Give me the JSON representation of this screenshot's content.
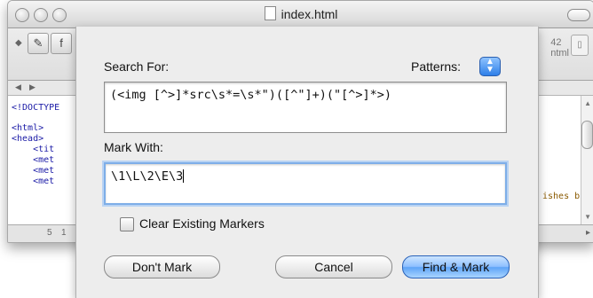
{
  "window": {
    "title": "index.html",
    "toolbar_right_top": "42",
    "toolbar_right_bottom": "ntml",
    "code_lines": [
      "<!DOCTYPE",
      "<html>",
      "<head>",
      "    <tit",
      "    <met",
      "    <met",
      "    <met"
    ],
    "code_tail": "ishes b",
    "status_line": "5",
    "status_col": "1"
  },
  "dialog": {
    "search_label": "Search For:",
    "patterns_label": "Patterns:",
    "search_value": "(<img [^>]*src\\s*=\\s*\")([^\"]+)(\"[^>]*>)",
    "mark_label": "Mark With:",
    "mark_value": "\\1\\L\\2\\E\\3",
    "clear_markers_label": "Clear Existing Markers",
    "clear_markers_checked": false,
    "dont_mark_label": "Don't Mark",
    "cancel_label": "Cancel",
    "find_mark_label": "Find & Mark"
  },
  "icons": {
    "patterns_button": "up-down-arrows-icon",
    "document": "document-icon"
  },
  "colors": {
    "default_button": "#5ea4f7",
    "focus_ring": "#7eaee8"
  }
}
